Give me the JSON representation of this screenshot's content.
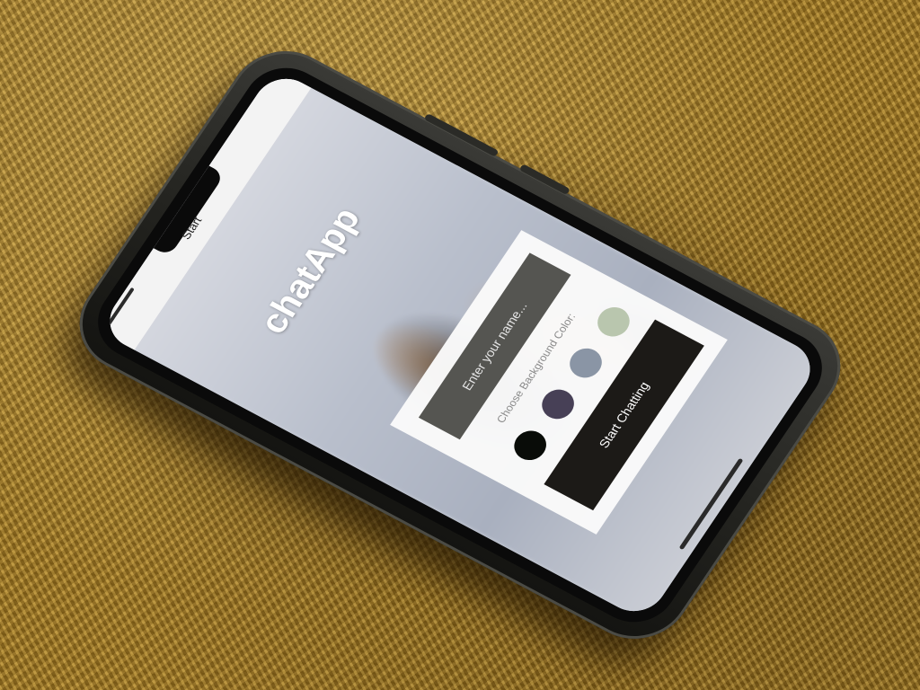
{
  "scene": {
    "description_object": "smartphone",
    "surface_color": "#a07a22"
  },
  "nav": {
    "title": "Start"
  },
  "app": {
    "title": "chatApp"
  },
  "form": {
    "name_placeholder": "Enter your name...",
    "bg_color_label": "Choose Background Color:",
    "colors": [
      "#090C08",
      "#474056",
      "#8A95A5",
      "#B9C6AE"
    ],
    "start_label": "Start Chatting"
  }
}
